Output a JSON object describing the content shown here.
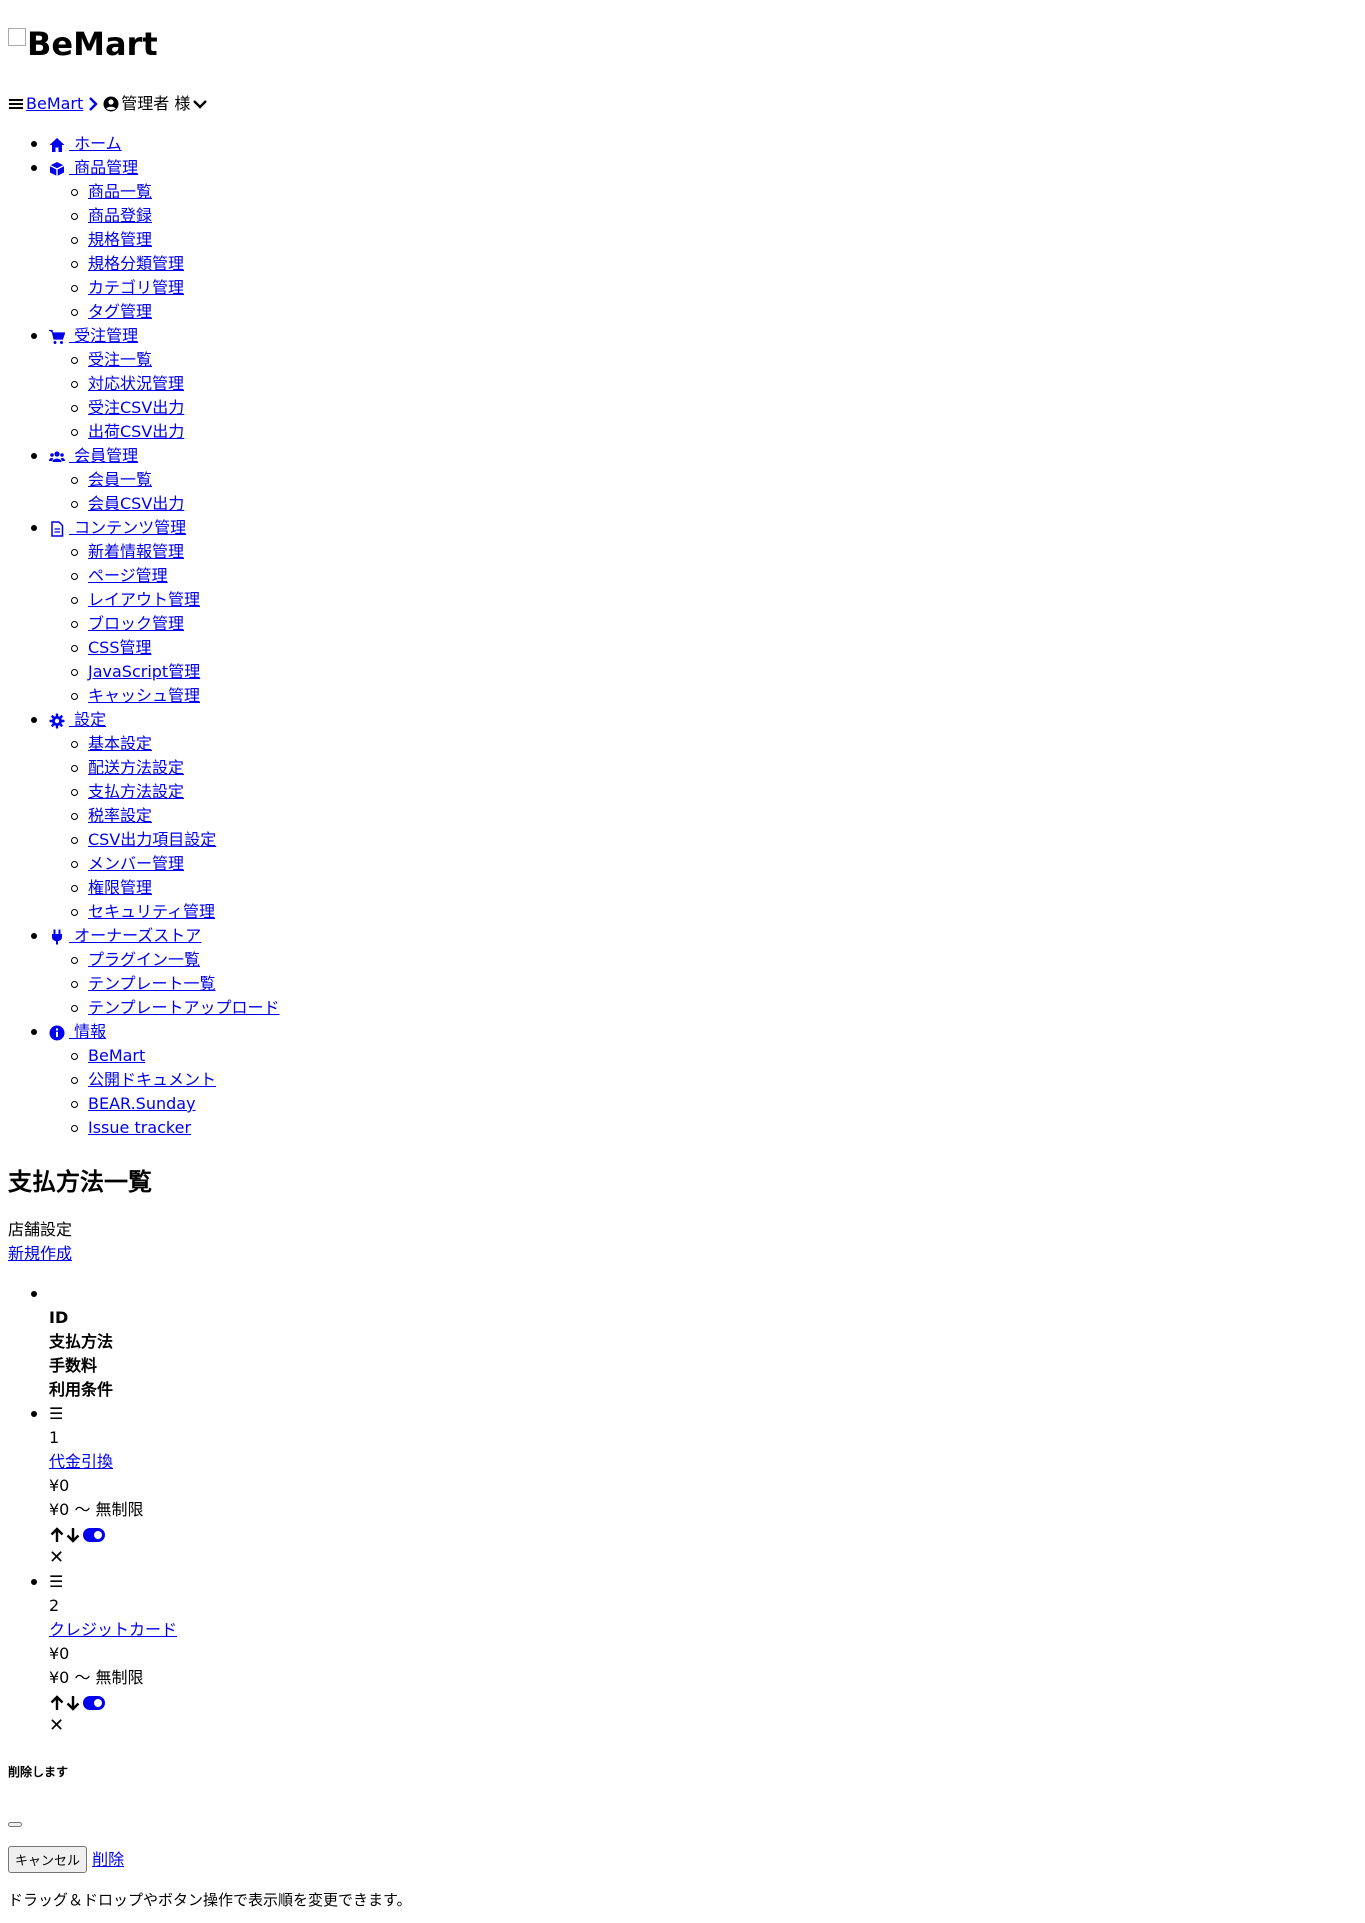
{
  "header": {
    "logo_alt": "BeMart",
    "breadcrumb_link": "BeMart",
    "user_label": "管理者 様"
  },
  "menu": [
    {
      "label": " ホーム",
      "icon": "home-icon",
      "children": []
    },
    {
      "label": " 商品管理",
      "icon": "cube-icon",
      "children": [
        "商品一覧",
        "商品登録",
        "規格管理",
        "規格分類管理",
        "カテゴリ管理",
        "タグ管理"
      ]
    },
    {
      "label": " 受注管理",
      "icon": "cart-icon",
      "children": [
        "受注一覧",
        "対応状況管理",
        "受注CSV出力",
        "出荷CSV出力"
      ]
    },
    {
      "label": " 会員管理",
      "icon": "users-icon",
      "children": [
        "会員一覧",
        "会員CSV出力"
      ]
    },
    {
      "label": " コンテンツ管理",
      "icon": "file-icon",
      "children": [
        "新着情報管理",
        "ページ管理",
        "レイアウト管理",
        "ブロック管理",
        "CSS管理",
        "JavaScript管理",
        "キャッシュ管理"
      ]
    },
    {
      "label": " 設定",
      "icon": "gear-icon",
      "children": [
        "基本設定",
        "配送方法設定",
        "支払方法設定",
        "税率設定",
        "CSV出力項目設定",
        "メンバー管理",
        "権限管理",
        "セキュリティ管理"
      ]
    },
    {
      "label": " オーナーズストア",
      "icon": "plug-icon",
      "children": [
        "プラグイン一覧",
        "テンプレート一覧",
        "テンプレートアップロード"
      ]
    },
    {
      "label": " 情報",
      "icon": "info-icon",
      "children": [
        "BeMart",
        "公開ドキュメント",
        "BEAR.Sunday",
        "Issue tracker"
      ]
    }
  ],
  "page": {
    "title": "支払方法一覧",
    "section": "店舗設定",
    "new_link": "新規作成"
  },
  "table": {
    "headers": [
      "ID",
      "支払方法",
      "手数料",
      "利用条件"
    ],
    "rows": [
      {
        "handle": "☰",
        "id": "1",
        "name": "代金引換",
        "fee": "¥0",
        "condition": "¥0 〜 無制限",
        "enabled": true,
        "delete": "✕"
      },
      {
        "handle": "☰",
        "id": "2",
        "name": "クレジットカード",
        "fee": "¥0",
        "condition": "¥0 〜 無制限",
        "enabled": true,
        "delete": "✕"
      }
    ]
  },
  "modal": {
    "title": "削除します",
    "cancel": "キャンセル",
    "delete": "削除"
  },
  "footer_note": "ドラッグ＆ドロップやボタン操作で表示順を変更できます。",
  "colors": {
    "link": "#0000ee",
    "text": "#000000",
    "background": "#ffffff"
  }
}
